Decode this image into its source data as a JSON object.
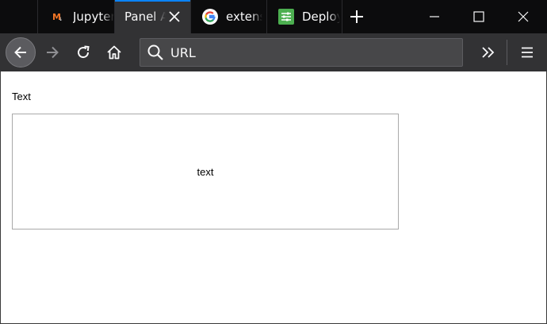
{
  "browser": {
    "tabs": [
      {
        "title": "Jupyter",
        "state": "inactive",
        "favicon": "jupyter-icon"
      },
      {
        "title": "Panel App",
        "state": "active",
        "favicon": "none"
      },
      {
        "title": "extensions",
        "state": "inactive",
        "favicon": "google-icon"
      },
      {
        "title": "Deploy",
        "state": "inactive",
        "favicon": "sliders-icon"
      }
    ],
    "url_placeholder": "URL",
    "accent_color": "#0a84ff"
  },
  "page": {
    "label": "Text",
    "textbox_value": "text"
  }
}
